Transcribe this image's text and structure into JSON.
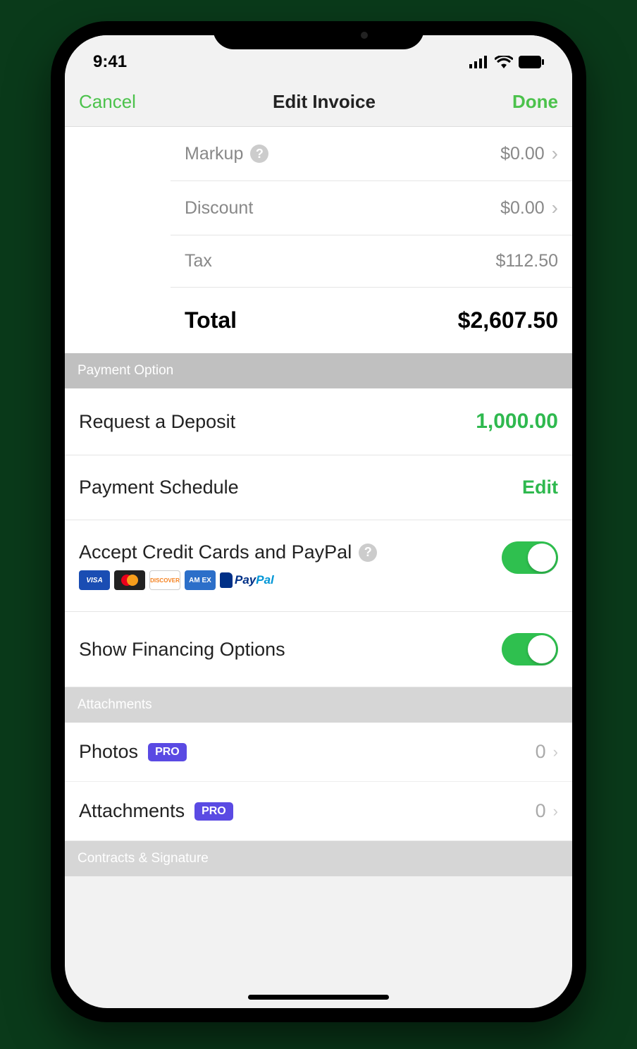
{
  "status": {
    "time": "9:41"
  },
  "nav": {
    "cancel": "Cancel",
    "title": "Edit Invoice",
    "done": "Done"
  },
  "summary": {
    "markup_label": "Markup",
    "markup_value": "$0.00",
    "discount_label": "Discount",
    "discount_value": "$0.00",
    "tax_label": "Tax",
    "tax_value": "$112.50",
    "total_label": "Total",
    "total_value": "$2,607.50"
  },
  "sections": {
    "payment_option": "Payment Option",
    "attachments": "Attachments",
    "contracts": "Contracts & Signature"
  },
  "payment": {
    "deposit_label": "Request a Deposit",
    "deposit_value": "1,000.00",
    "schedule_label": "Payment Schedule",
    "schedule_action": "Edit",
    "accept_label": "Accept Credit Cards and PayPal",
    "financing_label": "Show Financing Options"
  },
  "cards": {
    "visa": "VISA",
    "discover": "DISCOVER",
    "amex": "AM EX",
    "paypal_pay": "Pay",
    "paypal_pal": "Pal"
  },
  "badges": {
    "pro": "PRO"
  },
  "attachments": {
    "photos_label": "Photos",
    "photos_count": "0",
    "attachments_label": "Attachments",
    "attachments_count": "0"
  }
}
